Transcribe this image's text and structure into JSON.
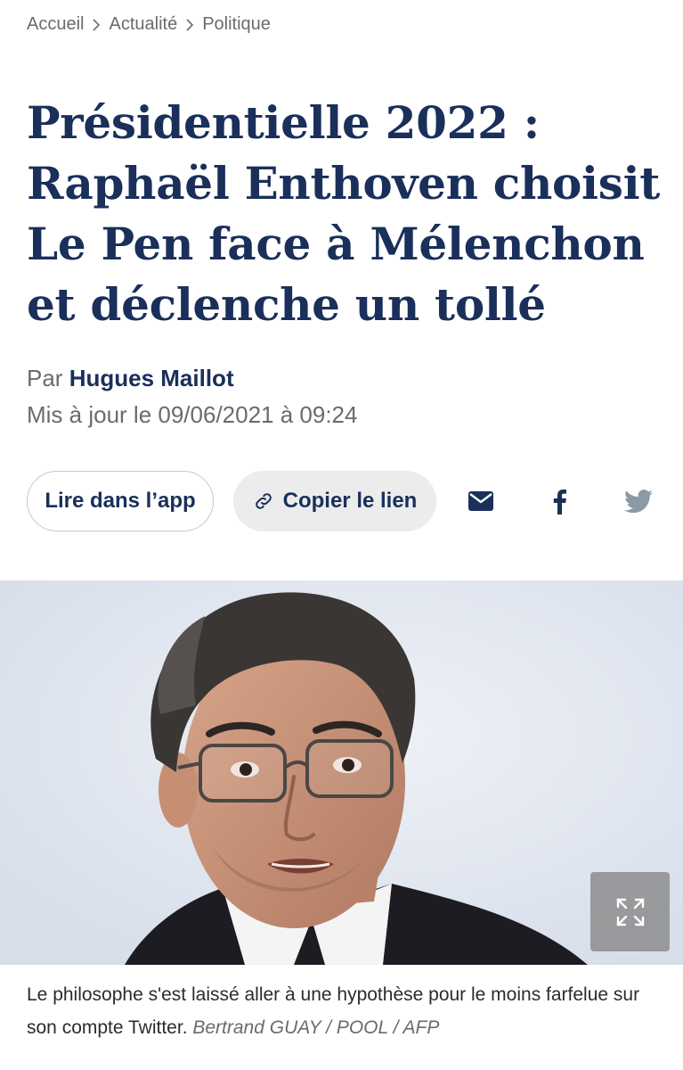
{
  "breadcrumb": {
    "items": [
      "Accueil",
      "Actualité",
      "Politique"
    ]
  },
  "article": {
    "title": "Présidentielle 2022 : Raphaël Enthoven choisit Le Pen face à Mélenchon et déclenche un tollé",
    "by_prefix": "Par",
    "author": "Hugues Maillot",
    "updated": "Mis à jour le 09/06/2021 à 09:24"
  },
  "actions": {
    "read_in_app": "Lire dans l’app",
    "copy_link": "Copier le lien",
    "share_icons": [
      "mail-icon",
      "facebook-icon",
      "twitter-icon"
    ]
  },
  "image": {
    "caption": "Le philosophe s'est laissé aller à une hypothèse pour le moins farfelue sur son compte Twitter.",
    "credit": "Bertrand GUAY / POOL / AFP"
  },
  "colors": {
    "navy": "#1a2f5a",
    "muted": "#6b6b6b",
    "pill_bg": "#ececec",
    "twitter_muted": "#8c9aa6"
  }
}
